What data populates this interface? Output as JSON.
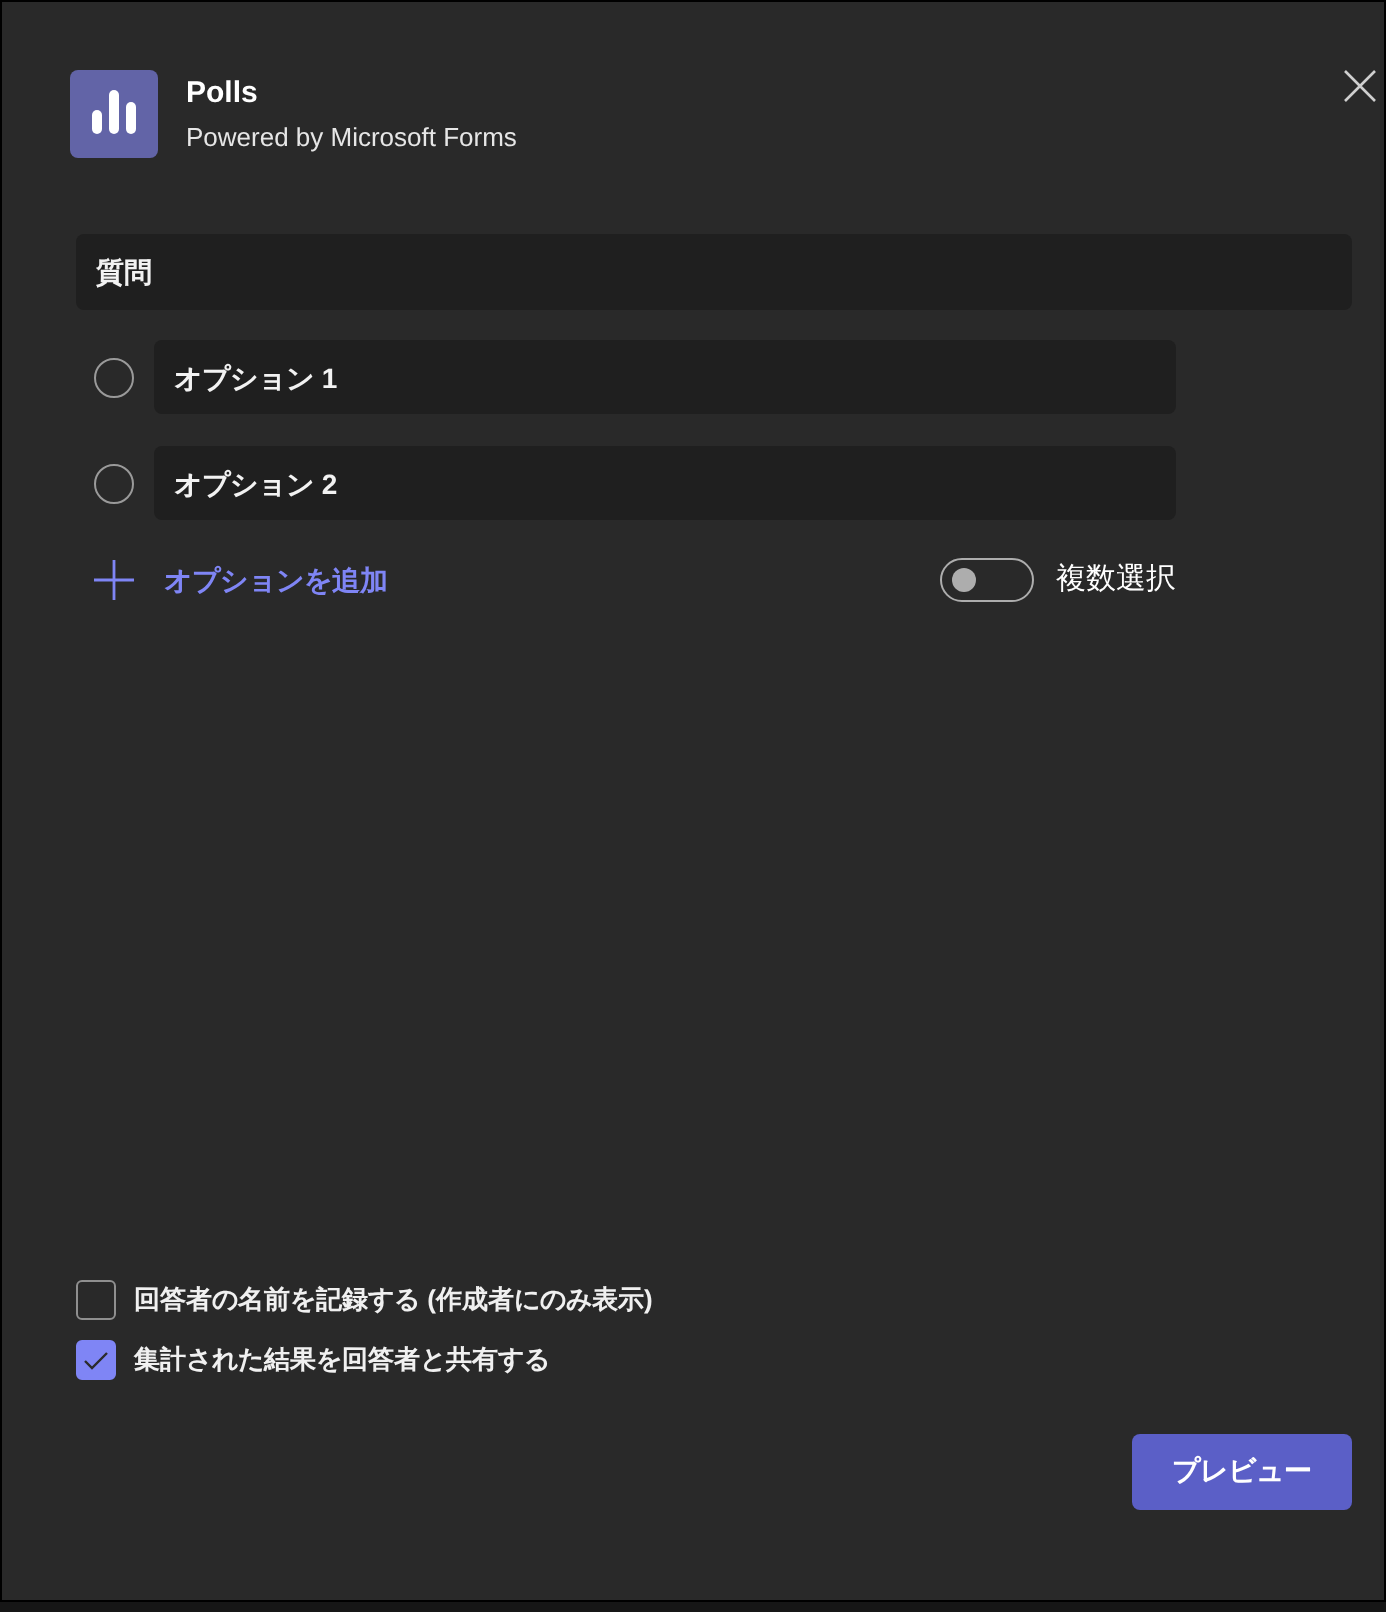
{
  "app": {
    "title": "Polls",
    "subtitle": "Powered by Microsoft Forms"
  },
  "question": {
    "placeholder": "質問"
  },
  "options": [
    {
      "placeholder": "オプション 1",
      "selected": false
    },
    {
      "placeholder": "オプション 2",
      "selected": false
    }
  ],
  "add_option": {
    "label": "オプションを追加"
  },
  "multiple_choice": {
    "label": "複数選択",
    "on": false
  },
  "settings": [
    {
      "label": "回答者の名前を記録する (作成者にのみ表示)",
      "checked": false
    },
    {
      "label": "集計された結果を回答者と共有する",
      "checked": true
    }
  ],
  "preview_button": {
    "label": "プレビュー"
  }
}
